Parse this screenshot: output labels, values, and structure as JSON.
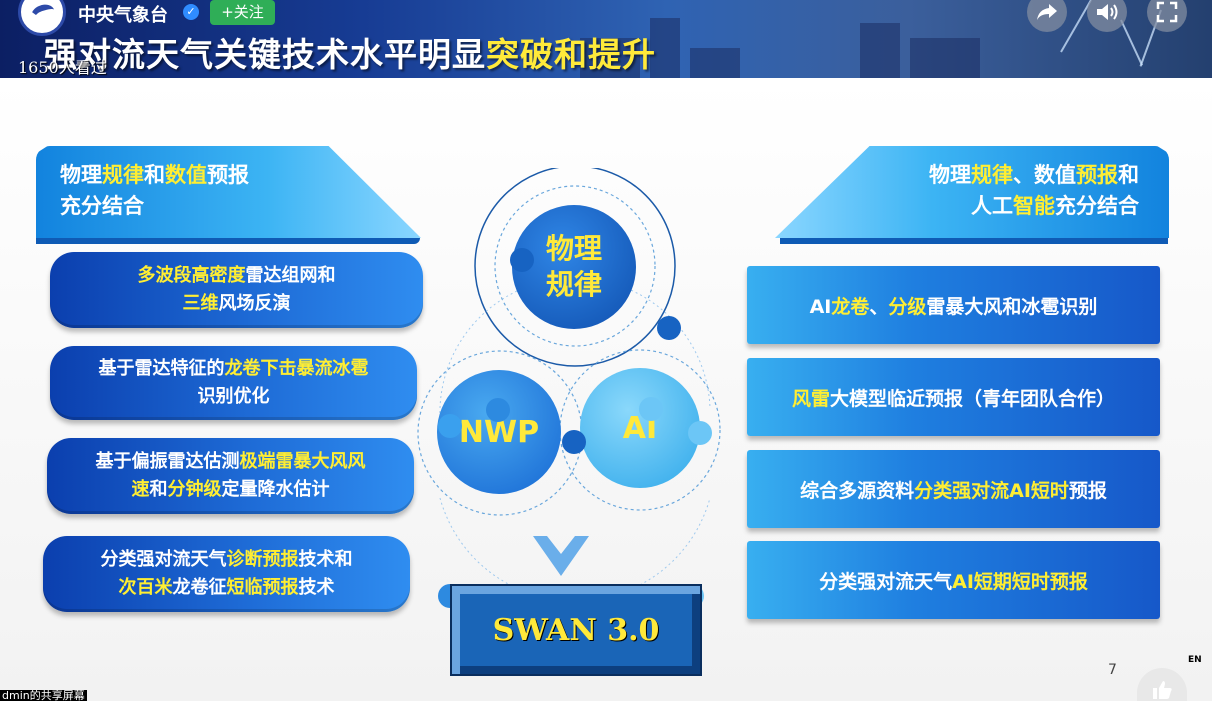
{
  "header": {
    "channel_name": "中央气象台",
    "verified_mark": "✓",
    "follow_label": "+关注",
    "viewer_count_text": "1650人看过",
    "title_prefix": "强对流天气关键技术水平明显",
    "title_highlight": "突破和提升",
    "controls": [
      "share-icon",
      "volume-icon",
      "fullscreen-icon"
    ]
  },
  "left_column": {
    "header": {
      "line1": [
        {
          "t": "物理",
          "h": false
        },
        {
          "t": "规律",
          "h": true
        },
        {
          "t": "和",
          "h": false
        },
        {
          "t": "数值",
          "h": true
        },
        {
          "t": "预报",
          "h": false
        }
      ],
      "line2": "充分结合"
    },
    "items": [
      {
        "l1": [
          {
            "t": "多波段高密度",
            "h": true
          },
          {
            "t": "雷达组网和",
            "h": false
          }
        ],
        "l2": [
          {
            "t": "三维",
            "h": true
          },
          {
            "t": "风场反演",
            "h": false
          }
        ]
      },
      {
        "l1": [
          {
            "t": "基于雷达特征的",
            "h": false
          },
          {
            "t": "龙卷下击暴流冰雹",
            "h": true
          }
        ],
        "l2": [
          {
            "t": "识别优化",
            "h": false
          }
        ]
      },
      {
        "l1": [
          {
            "t": "基于偏振雷达估测",
            "h": false
          },
          {
            "t": "极端雷暴大风风",
            "h": true
          }
        ],
        "l2": [
          {
            "t": "速",
            "h": true
          },
          {
            "t": "和",
            "h": false
          },
          {
            "t": "分钟级",
            "h": true
          },
          {
            "t": "定量降水估计",
            "h": false
          }
        ]
      },
      {
        "l1": [
          {
            "t": "分类强对流天气",
            "h": false
          },
          {
            "t": "诊断预报",
            "h": true
          },
          {
            "t": "技术和",
            "h": false
          }
        ],
        "l2": [
          {
            "t": "次百米",
            "h": true
          },
          {
            "t": "龙卷征",
            "h": false
          },
          {
            "t": "短临预报",
            "h": true
          },
          {
            "t": "技术",
            "h": false
          }
        ]
      }
    ]
  },
  "right_column": {
    "header": {
      "line1": [
        {
          "t": "物理",
          "h": false
        },
        {
          "t": "规律",
          "h": true
        },
        {
          "t": "、数值",
          "h": false
        },
        {
          "t": "预报",
          "h": true
        },
        {
          "t": "和",
          "h": false
        }
      ],
      "line2": [
        {
          "t": "人工",
          "h": false
        },
        {
          "t": "智能",
          "h": true
        },
        {
          "t": "充分结合",
          "h": false
        }
      ]
    },
    "items": [
      [
        {
          "t": "AI",
          "h": false
        },
        {
          "t": "龙卷",
          "h": true
        },
        {
          "t": "、",
          "h": false
        },
        {
          "t": "分级",
          "h": true
        },
        {
          "t": "雷暴大风和冰雹识别",
          "h": false
        }
      ],
      [
        {
          "t": "风雷",
          "h": true
        },
        {
          "t": "大模型临近预报（青年团队合作）",
          "h": false
        }
      ],
      [
        {
          "t": "综合多源资料",
          "h": false
        },
        {
          "t": "分类强对流AI短时",
          "h": true
        },
        {
          "t": "预报",
          "h": false
        }
      ],
      [
        {
          "t": "分类强对流天气",
          "h": false
        },
        {
          "t": "AI短期短时预报",
          "h": true
        }
      ]
    ]
  },
  "diagram": {
    "top_circle_line1": "物理",
    "top_circle_line2": "规律",
    "left_circle": "NWP",
    "right_circle": "AI",
    "result_label": "SWAN 3.0"
  },
  "footer": {
    "page_number": "7",
    "lang_badge": "EN",
    "share_note": "dmin的共享屏幕"
  },
  "colors": {
    "highlight": "#ffee33",
    "pill_blue": "#1e6bd6",
    "box_blue": "#1f7fe0",
    "follow_green": "#2fae57"
  }
}
